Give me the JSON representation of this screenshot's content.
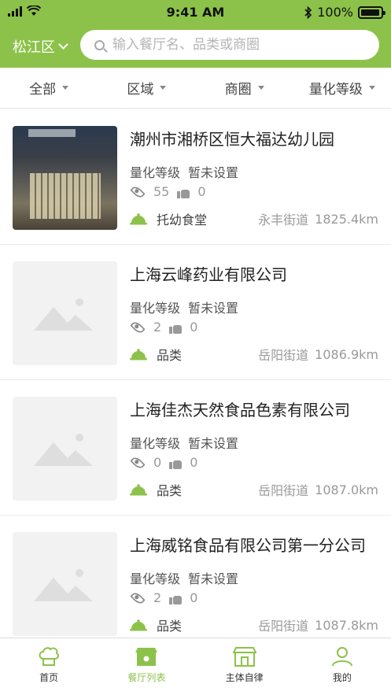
{
  "status_bar": {
    "time": "9:41 AM",
    "battery": "100%"
  },
  "header": {
    "city": "松江区",
    "search_placeholder": "输入餐厅名、品类或商圈"
  },
  "filters": [
    {
      "label": "全部"
    },
    {
      "label": "区域"
    },
    {
      "label": "商圈"
    },
    {
      "label": "量化等级"
    }
  ],
  "restaurants": [
    {
      "name": "潮州市湘桥区恒大福达幼儿园",
      "grade_label": "量化等级",
      "grade_value": "暂未设置",
      "views": "55",
      "likes": "0",
      "category": "托幼食堂",
      "street": "永丰街道",
      "distance": "1825.4km",
      "image": "photo"
    },
    {
      "name": "上海云峰药业有限公司",
      "grade_label": "量化等级",
      "grade_value": "暂未设置",
      "views": "2",
      "likes": "0",
      "category": "品类",
      "street": "岳阳街道",
      "distance": "1086.9km",
      "image": "placeholder"
    },
    {
      "name": "上海佳杰天然食品色素有限公司",
      "grade_label": "量化等级",
      "grade_value": "暂未设置",
      "views": "0",
      "likes": "0",
      "category": "品类",
      "street": "岳阳街道",
      "distance": "1087.0km",
      "image": "placeholder"
    },
    {
      "name": "上海威铭食品有限公司第一分公司",
      "grade_label": "量化等级",
      "grade_value": "暂未设置",
      "views": "2",
      "likes": "0",
      "category": "品类",
      "street": "岳阳街道",
      "distance": "1087.8km",
      "image": "placeholder"
    }
  ],
  "tabs": [
    {
      "label": "首页",
      "icon": "chef-hat-icon",
      "active": false
    },
    {
      "label": "餐厅列表",
      "icon": "storefront-icon",
      "active": true
    },
    {
      "label": "主体自律",
      "icon": "shop-icon",
      "active": false
    },
    {
      "label": "我的",
      "icon": "user-icon",
      "active": false
    }
  ],
  "colors": {
    "brand": "#8cc24a",
    "text": "#333333",
    "muted": "#999999"
  }
}
